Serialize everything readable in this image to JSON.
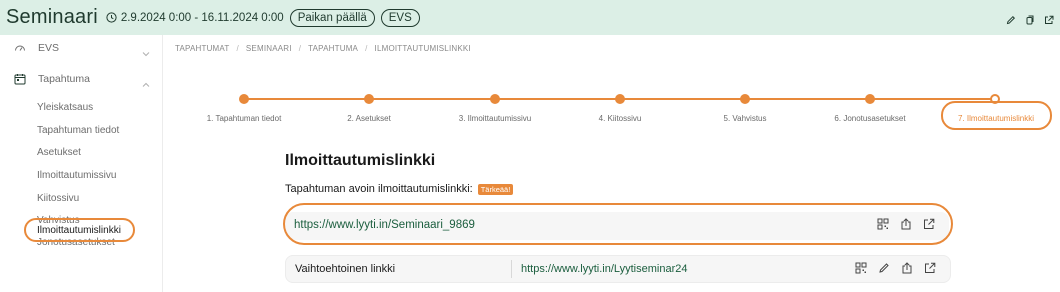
{
  "header": {
    "title": "Seminaari",
    "date_range": "2.9.2024 0:00 - 16.11.2024 0:00",
    "location_pill": "Paikan päällä",
    "code_pill": "EVS"
  },
  "sidebar": {
    "sections": [
      {
        "label": "EVS",
        "icon": "gauge-icon"
      },
      {
        "label": "Tapahtuma",
        "icon": "calendar-icon"
      }
    ],
    "items": [
      {
        "label": "Yleiskatsaus"
      },
      {
        "label": "Tapahtuman tiedot"
      },
      {
        "label": "Asetukset"
      },
      {
        "label": "Ilmoittautumissivu"
      },
      {
        "label": "Kiitossivu"
      },
      {
        "label": "Vahvistus"
      },
      {
        "label": "Jonotusasetukset"
      },
      {
        "label": "Ilmoittautumislinkki"
      }
    ],
    "active_item": "Ilmoittautumislinkki"
  },
  "breadcrumb": [
    "TAPAHTUMAT",
    "SEMINAARI",
    "TAPAHTUMA",
    "ILMOITTAUTUMISLINKKI"
  ],
  "stepper": {
    "steps": [
      "1. Tapahtuman tiedot",
      "2. Asetukset",
      "3. Ilmoittautumissivu",
      "4. Kiitossivu",
      "5. Vahvistus",
      "6. Jonotusasetukset",
      "7. Ilmoittautumislinkki"
    ],
    "active_step": 7
  },
  "main": {
    "title": "Ilmoittautumislinkki",
    "subtitle": "Tapahtuman avoin ilmoittautumislinkki:",
    "badge": "Tärkeää!",
    "primary_link": "https://www.lyyti.in/Seminaari_9869",
    "alt_label": "Vaihtoehtoinen linkki",
    "alt_link": "https://www.lyyti.in/Lyytiseminar24"
  },
  "colors": {
    "accent": "#e8893a",
    "header_bg": "#dcefe6",
    "link_green": "#1b5e3e"
  }
}
